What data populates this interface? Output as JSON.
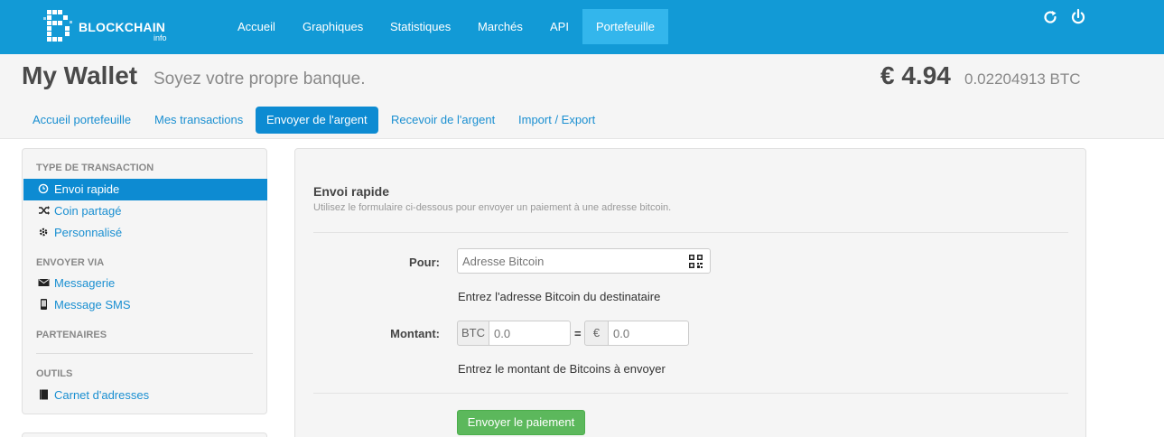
{
  "navbar": {
    "logo_text": "BLOCKCHAIN",
    "logo_sub": "info",
    "items": [
      {
        "label": "Accueil"
      },
      {
        "label": "Graphiques"
      },
      {
        "label": "Statistiques"
      },
      {
        "label": "Marchés"
      },
      {
        "label": "API"
      },
      {
        "label": "Portefeuille"
      }
    ],
    "active_item": "Portefeuille",
    "icons": [
      "refresh-icon",
      "power-icon"
    ],
    "color": "#129ad6"
  },
  "header": {
    "title": "My Wallet",
    "subtitle": "Soyez votre propre banque.",
    "balance_fiat": "€ 4.94",
    "balance_btc": "0.02204913 BTC",
    "tabs": [
      {
        "label": "Accueil portefeuille"
      },
      {
        "label": "Mes transactions"
      },
      {
        "label": "Envoyer de l'argent"
      },
      {
        "label": "Recevoir de l'argent"
      },
      {
        "label": "Import / Export"
      }
    ],
    "active_tab": "Envoyer de l'argent"
  },
  "sidebar": {
    "sections": [
      {
        "heading": "TYPE DE TRANSACTION",
        "items": [
          {
            "label": "Envoi rapide",
            "icon": "clock-icon"
          },
          {
            "label": "Coin partagé",
            "icon": "shuffle-icon"
          },
          {
            "label": "Personnalisé",
            "icon": "gear-icon"
          }
        ]
      },
      {
        "heading": "ENVOYER VIA",
        "items": [
          {
            "label": "Messagerie",
            "icon": "envelope-icon"
          },
          {
            "label": "Message SMS",
            "icon": "phone-icon"
          }
        ]
      },
      {
        "heading": "PARTENAIRES",
        "items": []
      },
      {
        "heading": "OUTILS",
        "items": [
          {
            "label": "Carnet d'adresses",
            "icon": "book-icon"
          }
        ]
      }
    ],
    "active_item": "Envoi rapide"
  },
  "form": {
    "title": "Envoi rapide",
    "description": "Utilisez le formulaire ci-dessous pour envoyer un paiement à une adresse bitcoin.",
    "to_label": "Pour:",
    "to_placeholder": "Adresse Bitcoin",
    "to_help": "Entrez l'adresse Bitcoin du destinataire",
    "amount_label": "Montant:",
    "btc_addon": "BTC",
    "btc_placeholder": "0.0",
    "equals": "=",
    "fiat_addon": "€",
    "fiat_placeholder": "0.0",
    "amount_help": "Entrez le montant de Bitcoins à envoyer",
    "submit_label": "Envoyer le paiement"
  },
  "colors": {
    "accent": "#0d8bd2",
    "link": "#1a8fd1",
    "success": "#5cb85c"
  }
}
